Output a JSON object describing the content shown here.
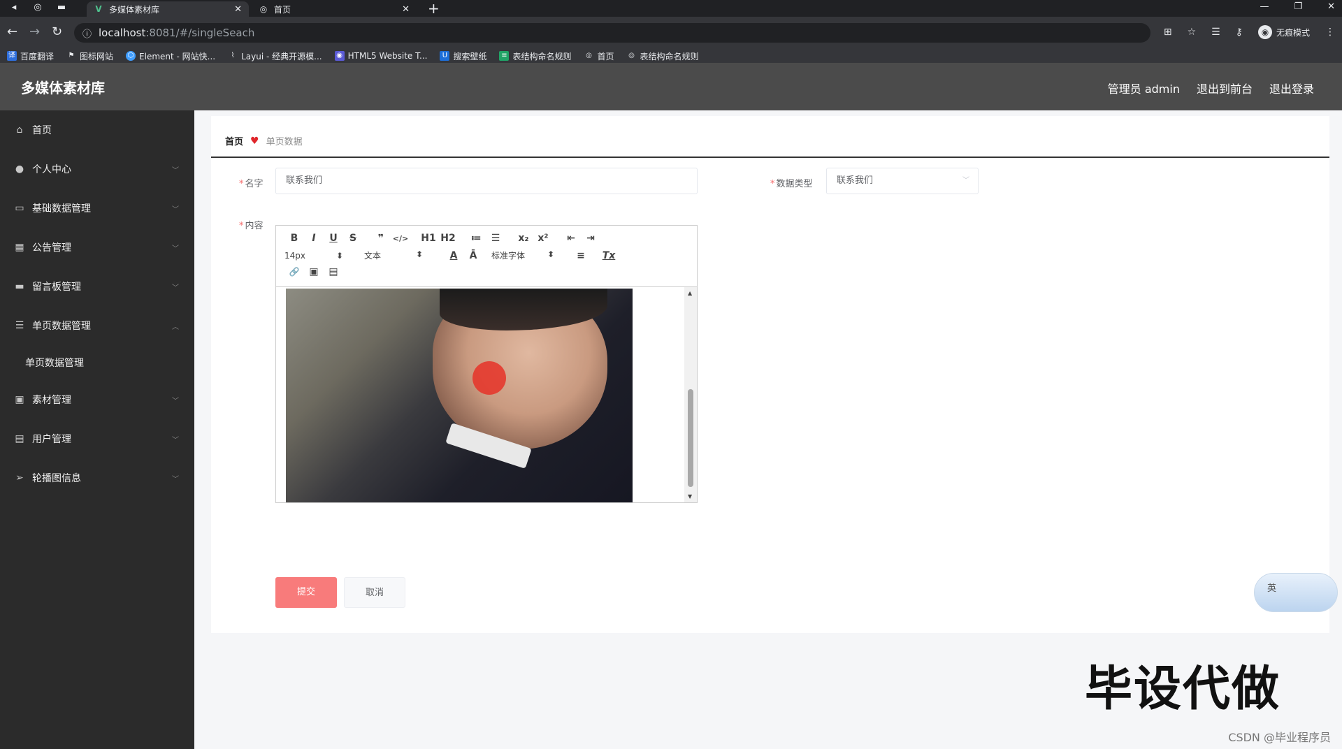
{
  "browser": {
    "tabs": [
      {
        "title": "多媒体素材库",
        "active": true,
        "favicon": "vue-icon"
      },
      {
        "title": "首页",
        "active": false,
        "favicon": "globe-icon"
      }
    ],
    "url_host": "localhost",
    "url_path": ":8081/#/singleSeach",
    "profile_label": "无痕模式",
    "bookmarks": [
      {
        "label": "百度翻译",
        "color": "#2f6fdd"
      },
      {
        "label": "图标网站",
        "color": "#222222"
      },
      {
        "label": "Element - 网站快...",
        "color": "#409eff"
      },
      {
        "label": "Layui - 经典开源模...",
        "color": "#555555"
      },
      {
        "label": "HTML5 Website T...",
        "color": "#5b5bd6"
      },
      {
        "label": "搜索壁纸",
        "color": "#1e6fd9"
      },
      {
        "label": "表结构命名规则",
        "color": "#21a366"
      },
      {
        "label": "首页",
        "color": "#5f6368"
      },
      {
        "label": "表结构命名规则",
        "color": "#5f6368"
      }
    ]
  },
  "header": {
    "title": "多媒体素材库",
    "links": [
      "管理员 admin",
      "退出到前台",
      "退出登录"
    ]
  },
  "sidebar": {
    "items": [
      {
        "label": "首页",
        "icon": "home-icon",
        "arrow": ""
      },
      {
        "label": "个人中心",
        "icon": "user-icon",
        "arrow": "﹀"
      },
      {
        "label": "基础数据管理",
        "icon": "message-icon",
        "arrow": "﹀"
      },
      {
        "label": "公告管理",
        "icon": "grid-icon",
        "arrow": "﹀"
      },
      {
        "label": "留言板管理",
        "icon": "briefcase-icon",
        "arrow": "﹀"
      },
      {
        "label": "单页数据管理",
        "icon": "list-icon",
        "arrow": "︿"
      },
      {
        "label": "素材管理",
        "icon": "monitor-icon",
        "arrow": "﹀"
      },
      {
        "label": "用户管理",
        "icon": "clipboard-icon",
        "arrow": "﹀"
      },
      {
        "label": "轮播图信息",
        "icon": "send-icon",
        "arrow": "﹀"
      }
    ],
    "submenu": {
      "label": "单页数据管理"
    }
  },
  "breadcrumb": {
    "home": "首页",
    "current": "单页数据"
  },
  "form": {
    "name_label": "名字",
    "name_value": "联系我们",
    "type_label": "数据类型",
    "type_value": "联系我们",
    "content_label": "内容",
    "toolbar": {
      "row1": [
        "B",
        "I",
        "U",
        "S",
        "❞",
        "</>",
        "H1",
        "H2",
        "≔",
        "☰",
        "x₂",
        "x²",
        "⇤",
        "⇥"
      ],
      "size": "14px",
      "format": "文本",
      "font": "标准字体",
      "color_btn": "A",
      "bg_btn": "Ā",
      "align": "≡",
      "clear": "Tx",
      "row3": [
        "🔗",
        "▣",
        "▤"
      ]
    }
  },
  "buttons": {
    "submit": "提交",
    "cancel": "取消"
  },
  "ime": {
    "label": "英"
  },
  "overlay": {
    "watermark": "毕设代做",
    "credit": "CSDN @毕业程序员"
  }
}
